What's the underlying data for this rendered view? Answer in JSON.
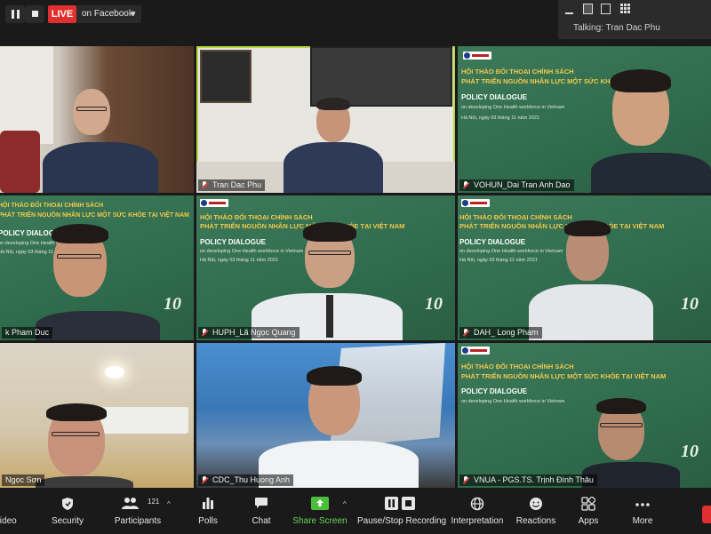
{
  "topbar": {
    "live_badge": "LIVE",
    "live_destination": "on Facebook",
    "talking_label": "Talking: Tran Dac Phu"
  },
  "tiles": [
    {
      "name": "",
      "bg": "room-wood"
    },
    {
      "name": "Tran Dac Phu",
      "bg": "office-white",
      "active": true
    },
    {
      "name": "VOHUN_Dai Tran Anh Dao",
      "bg": "slide"
    },
    {
      "name": "k Pham Duc",
      "bg": "slide"
    },
    {
      "name": "HUPH_Lã Ngọc Quang",
      "bg": "slide"
    },
    {
      "name": "DAH_ Long Pham",
      "bg": "slide"
    },
    {
      "name": "Ngọc Sơn",
      "bg": "room-beige"
    },
    {
      "name": "CDC_Thu Huong Anh",
      "bg": "ship"
    },
    {
      "name": "VNUA - PGS.TS. Trịnh Đình Thâu",
      "bg": "slide"
    }
  ],
  "slide": {
    "title_line1": "HỘI THẢO ĐỐI THOẠI CHÍNH SÁCH",
    "title_line2": "PHÁT TRIỂN NGUỒN NHÂN LỰC MỘT SỨC KHỎE TẠI VIỆT NAM",
    "policy": "POLICY DIALOGUE",
    "subtitle": "on developing One Health workforce in Vietnam",
    "date": "Hà Nội, ngày 03 tháng 11 năm 2021",
    "logo": "10"
  },
  "toolbar": {
    "items": [
      {
        "label": "Video",
        "icon": "video-icon"
      },
      {
        "label": "Security",
        "icon": "shield-icon"
      },
      {
        "label": "Participants",
        "icon": "participants-icon",
        "count": "121"
      },
      {
        "label": "Polls",
        "icon": "polls-icon"
      },
      {
        "label": "Chat",
        "icon": "chat-icon"
      },
      {
        "label": "Share Screen",
        "icon": "share-screen-icon"
      },
      {
        "label": "Pause/Stop Recording",
        "icon": "pause-stop-icon"
      },
      {
        "label": "Interpretation",
        "icon": "globe-icon"
      },
      {
        "label": "Reactions",
        "icon": "smiley-icon"
      },
      {
        "label": "Apps",
        "icon": "apps-icon"
      },
      {
        "label": "More",
        "icon": "more-icon"
      }
    ]
  },
  "colors": {
    "live_red": "#e02f2f",
    "active_speaker": "#b6d642",
    "share_green": "#6ad45a",
    "slide_green": "#2f6b4c"
  }
}
